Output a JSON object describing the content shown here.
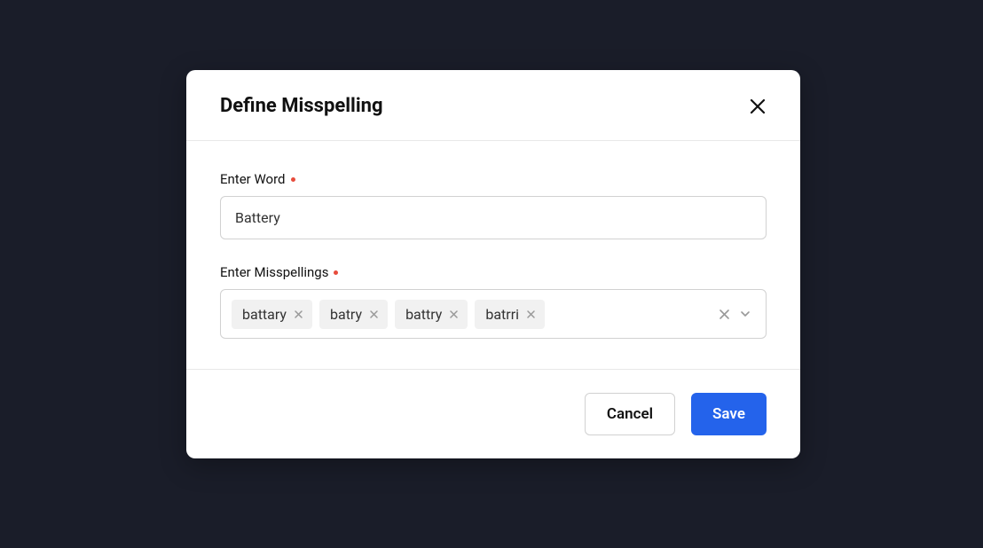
{
  "modal": {
    "title": "Define Misspelling",
    "word_label": "Enter Word",
    "word_value": "Battery",
    "misspellings_label": "Enter Misspellings",
    "misspellings": [
      "battary",
      "batry",
      "battry",
      "batrri"
    ],
    "cancel_label": "Cancel",
    "save_label": "Save"
  }
}
